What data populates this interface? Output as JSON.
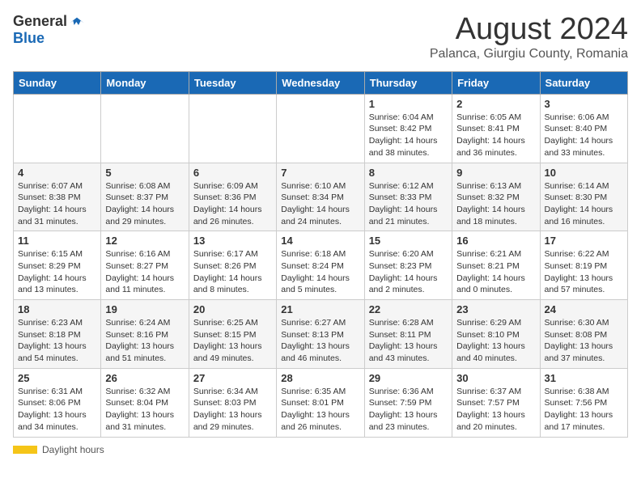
{
  "header": {
    "logo_general": "General",
    "logo_blue": "Blue",
    "main_title": "August 2024",
    "subtitle": "Palanca, Giurgiu County, Romania"
  },
  "days_of_week": [
    "Sunday",
    "Monday",
    "Tuesday",
    "Wednesday",
    "Thursday",
    "Friday",
    "Saturday"
  ],
  "weeks": [
    [
      {
        "day": "",
        "info": ""
      },
      {
        "day": "",
        "info": ""
      },
      {
        "day": "",
        "info": ""
      },
      {
        "day": "",
        "info": ""
      },
      {
        "day": "1",
        "info": "Sunrise: 6:04 AM\nSunset: 8:42 PM\nDaylight: 14 hours and 38 minutes."
      },
      {
        "day": "2",
        "info": "Sunrise: 6:05 AM\nSunset: 8:41 PM\nDaylight: 14 hours and 36 minutes."
      },
      {
        "day": "3",
        "info": "Sunrise: 6:06 AM\nSunset: 8:40 PM\nDaylight: 14 hours and 33 minutes."
      }
    ],
    [
      {
        "day": "4",
        "info": "Sunrise: 6:07 AM\nSunset: 8:38 PM\nDaylight: 14 hours and 31 minutes."
      },
      {
        "day": "5",
        "info": "Sunrise: 6:08 AM\nSunset: 8:37 PM\nDaylight: 14 hours and 29 minutes."
      },
      {
        "day": "6",
        "info": "Sunrise: 6:09 AM\nSunset: 8:36 PM\nDaylight: 14 hours and 26 minutes."
      },
      {
        "day": "7",
        "info": "Sunrise: 6:10 AM\nSunset: 8:34 PM\nDaylight: 14 hours and 24 minutes."
      },
      {
        "day": "8",
        "info": "Sunrise: 6:12 AM\nSunset: 8:33 PM\nDaylight: 14 hours and 21 minutes."
      },
      {
        "day": "9",
        "info": "Sunrise: 6:13 AM\nSunset: 8:32 PM\nDaylight: 14 hours and 18 minutes."
      },
      {
        "day": "10",
        "info": "Sunrise: 6:14 AM\nSunset: 8:30 PM\nDaylight: 14 hours and 16 minutes."
      }
    ],
    [
      {
        "day": "11",
        "info": "Sunrise: 6:15 AM\nSunset: 8:29 PM\nDaylight: 14 hours and 13 minutes."
      },
      {
        "day": "12",
        "info": "Sunrise: 6:16 AM\nSunset: 8:27 PM\nDaylight: 14 hours and 11 minutes."
      },
      {
        "day": "13",
        "info": "Sunrise: 6:17 AM\nSunset: 8:26 PM\nDaylight: 14 hours and 8 minutes."
      },
      {
        "day": "14",
        "info": "Sunrise: 6:18 AM\nSunset: 8:24 PM\nDaylight: 14 hours and 5 minutes."
      },
      {
        "day": "15",
        "info": "Sunrise: 6:20 AM\nSunset: 8:23 PM\nDaylight: 14 hours and 2 minutes."
      },
      {
        "day": "16",
        "info": "Sunrise: 6:21 AM\nSunset: 8:21 PM\nDaylight: 14 hours and 0 minutes."
      },
      {
        "day": "17",
        "info": "Sunrise: 6:22 AM\nSunset: 8:19 PM\nDaylight: 13 hours and 57 minutes."
      }
    ],
    [
      {
        "day": "18",
        "info": "Sunrise: 6:23 AM\nSunset: 8:18 PM\nDaylight: 13 hours and 54 minutes."
      },
      {
        "day": "19",
        "info": "Sunrise: 6:24 AM\nSunset: 8:16 PM\nDaylight: 13 hours and 51 minutes."
      },
      {
        "day": "20",
        "info": "Sunrise: 6:25 AM\nSunset: 8:15 PM\nDaylight: 13 hours and 49 minutes."
      },
      {
        "day": "21",
        "info": "Sunrise: 6:27 AM\nSunset: 8:13 PM\nDaylight: 13 hours and 46 minutes."
      },
      {
        "day": "22",
        "info": "Sunrise: 6:28 AM\nSunset: 8:11 PM\nDaylight: 13 hours and 43 minutes."
      },
      {
        "day": "23",
        "info": "Sunrise: 6:29 AM\nSunset: 8:10 PM\nDaylight: 13 hours and 40 minutes."
      },
      {
        "day": "24",
        "info": "Sunrise: 6:30 AM\nSunset: 8:08 PM\nDaylight: 13 hours and 37 minutes."
      }
    ],
    [
      {
        "day": "25",
        "info": "Sunrise: 6:31 AM\nSunset: 8:06 PM\nDaylight: 13 hours and 34 minutes."
      },
      {
        "day": "26",
        "info": "Sunrise: 6:32 AM\nSunset: 8:04 PM\nDaylight: 13 hours and 31 minutes."
      },
      {
        "day": "27",
        "info": "Sunrise: 6:34 AM\nSunset: 8:03 PM\nDaylight: 13 hours and 29 minutes."
      },
      {
        "day": "28",
        "info": "Sunrise: 6:35 AM\nSunset: 8:01 PM\nDaylight: 13 hours and 26 minutes."
      },
      {
        "day": "29",
        "info": "Sunrise: 6:36 AM\nSunset: 7:59 PM\nDaylight: 13 hours and 23 minutes."
      },
      {
        "day": "30",
        "info": "Sunrise: 6:37 AM\nSunset: 7:57 PM\nDaylight: 13 hours and 20 minutes."
      },
      {
        "day": "31",
        "info": "Sunrise: 6:38 AM\nSunset: 7:56 PM\nDaylight: 13 hours and 17 minutes."
      }
    ]
  ],
  "footer": {
    "daylight_label": "Daylight hours"
  }
}
